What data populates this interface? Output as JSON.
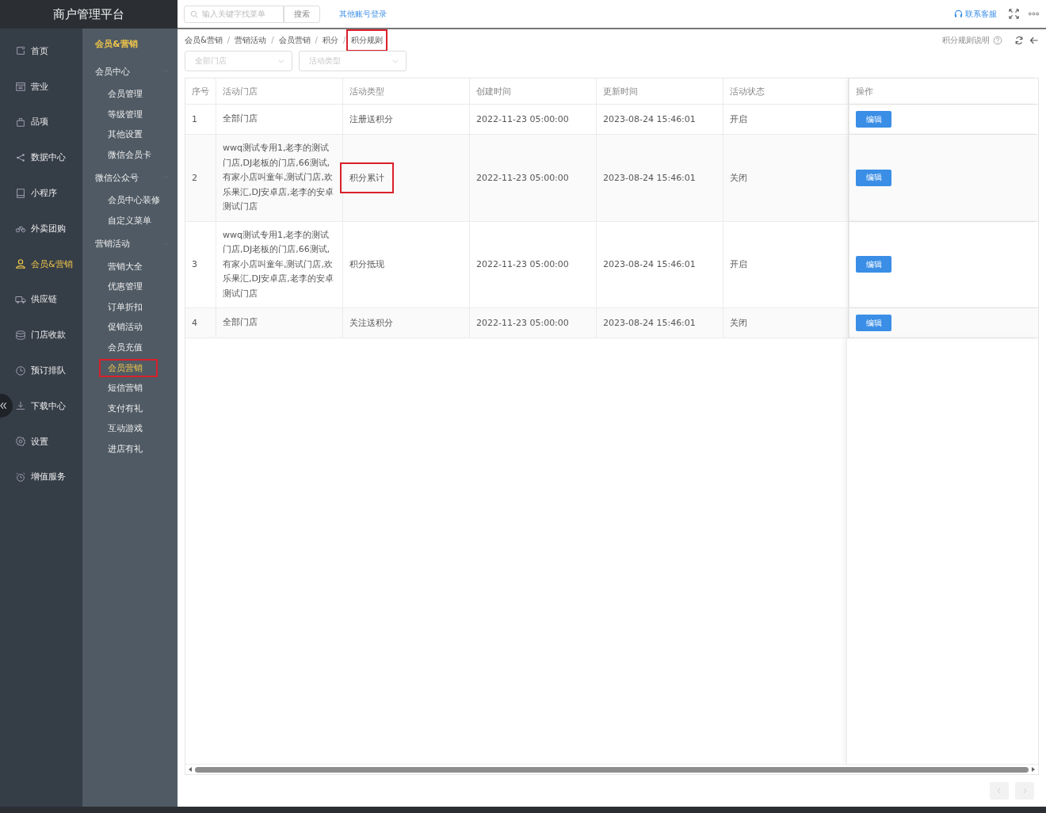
{
  "app_title": "商户管理平台",
  "topbar": {
    "search": {
      "placeholder": "输入关键字找菜单",
      "button": "搜索"
    },
    "other_login": "其他账号登录",
    "contact": "联系客服"
  },
  "sidebar": {
    "items": [
      {
        "label": "首页",
        "selected": false
      },
      {
        "label": "营业",
        "selected": false
      },
      {
        "label": "品项",
        "selected": false
      },
      {
        "label": "数据中心",
        "selected": false
      },
      {
        "label": "小程序",
        "selected": false
      },
      {
        "label": "外卖团购",
        "selected": false
      },
      {
        "label": "会员&营销",
        "selected": true
      },
      {
        "label": "供应链",
        "selected": false
      },
      {
        "label": "门店收款",
        "selected": false
      },
      {
        "label": "预订排队",
        "selected": false
      },
      {
        "label": "下载中心",
        "selected": false
      },
      {
        "label": "设置",
        "selected": false
      },
      {
        "label": "增值服务",
        "selected": false
      }
    ]
  },
  "submenu": {
    "title": "会员&营销",
    "groups": [
      {
        "label": "会员中心",
        "expanded": true,
        "children": [
          {
            "label": "会员管理",
            "selected": false,
            "highlighted": false
          },
          {
            "label": "等级管理",
            "selected": false,
            "highlighted": false
          },
          {
            "label": "其他设置",
            "selected": false,
            "highlighted": false
          },
          {
            "label": "微信会员卡",
            "selected": false,
            "highlighted": false
          }
        ]
      },
      {
        "label": "微信公众号",
        "expanded": true,
        "children": [
          {
            "label": "会员中心装修",
            "selected": false,
            "highlighted": false
          },
          {
            "label": "自定义菜单",
            "selected": false,
            "highlighted": false
          }
        ]
      },
      {
        "label": "营销活动",
        "expanded": true,
        "children": [
          {
            "label": "营销大全",
            "selected": false,
            "highlighted": false
          },
          {
            "label": "优惠管理",
            "selected": false,
            "highlighted": false
          },
          {
            "label": "订单折扣",
            "selected": false,
            "highlighted": false
          },
          {
            "label": "促销活动",
            "selected": false,
            "highlighted": false
          },
          {
            "label": "会员充值",
            "selected": false,
            "highlighted": false
          },
          {
            "label": "会员营销",
            "selected": true,
            "highlighted": true
          },
          {
            "label": "短信营销",
            "selected": false,
            "highlighted": false
          },
          {
            "label": "支付有礼",
            "selected": false,
            "highlighted": false
          },
          {
            "label": "互动游戏",
            "selected": false,
            "highlighted": false
          },
          {
            "label": "进店有礼",
            "selected": false,
            "highlighted": false
          }
        ]
      }
    ]
  },
  "breadcrumb_separator": "/",
  "breadcrumb": [
    {
      "label": "会员&营销",
      "highlighted": false
    },
    {
      "label": "营销活动",
      "highlighted": false
    },
    {
      "label": "会员营销",
      "highlighted": false
    },
    {
      "label": "积分",
      "highlighted": false
    },
    {
      "label": "积分规则",
      "highlighted": true
    }
  ],
  "help_link": "积分规则说明",
  "filters": [
    {
      "placeholder": "全部门店"
    },
    {
      "placeholder": "活动类型"
    }
  ],
  "table": {
    "columns": [
      "序号",
      "活动门店",
      "活动类型",
      "创建时间",
      "更新时间",
      "活动状态",
      "操作"
    ],
    "rows": [
      {
        "index": "1",
        "stores": "全部门店",
        "type": "注册送积分",
        "type_highlighted": false,
        "created": "2022-11-23 05:00:00",
        "updated": "2023-08-24 15:46:01",
        "status": "开启",
        "action": "编辑"
      },
      {
        "index": "2",
        "stores": "wwq测试专用1,老李的测试门店,DJ老板的门店,66测试,有家小店叫童年,测试门店,欢乐果汇,DJ安卓店,老李的安卓测试门店",
        "type": "积分累计",
        "type_highlighted": true,
        "created": "2022-11-23 05:00:00",
        "updated": "2023-08-24 15:46:01",
        "status": "关闭",
        "action": "编辑"
      },
      {
        "index": "3",
        "stores": "wwq测试专用1,老李的测试门店,DJ老板的门店,66测试,有家小店叫童年,测试门店,欢乐果汇,DJ安卓店,老李的安卓测试门店",
        "type": "积分抵现",
        "type_highlighted": false,
        "created": "2022-11-23 05:00:00",
        "updated": "2023-08-24 15:46:01",
        "status": "开启",
        "action": "编辑"
      },
      {
        "index": "4",
        "stores": "全部门店",
        "type": "关注送积分",
        "type_highlighted": false,
        "created": "2022-11-23 05:00:00",
        "updated": "2023-08-24 15:46:01",
        "status": "关闭",
        "action": "编辑"
      }
    ]
  }
}
